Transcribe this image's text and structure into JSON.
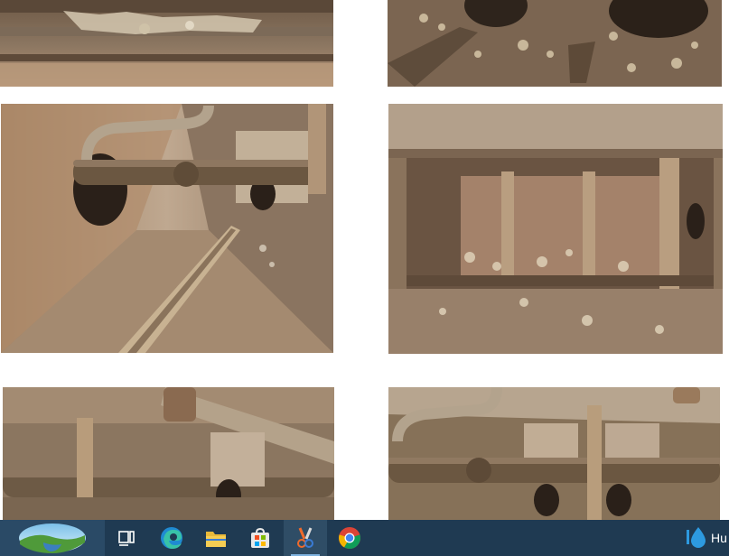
{
  "photos": [
    {
      "name": "photo-1"
    },
    {
      "name": "photo-2"
    },
    {
      "name": "photo-3"
    },
    {
      "name": "photo-4"
    },
    {
      "name": "photo-5"
    },
    {
      "name": "photo-6"
    }
  ],
  "taskbar": {
    "start_icon": "landscape-start-icon",
    "items": [
      {
        "icon": "task-view-icon"
      },
      {
        "icon": "edge-icon"
      },
      {
        "icon": "file-explorer-icon"
      },
      {
        "icon": "store-icon"
      },
      {
        "icon": "snipping-tool-icon",
        "active": true
      },
      {
        "icon": "chrome-icon"
      }
    ],
    "weather_icon": "weather-drop-icon",
    "weather_text": "Hu"
  },
  "colors": {
    "taskbar_bg": "#1f3a52",
    "rust": "#7a5a3a",
    "paint": "#d9cdb5"
  }
}
